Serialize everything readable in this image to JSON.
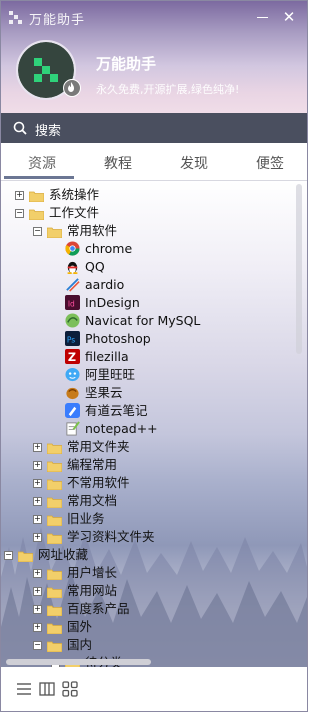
{
  "app": {
    "title": "万能助手"
  },
  "profile": {
    "name": "万能助手",
    "signature": "永久免费,开源扩展,绿色纯净!"
  },
  "search": {
    "label": "搜索"
  },
  "tabs": [
    {
      "label": "资源",
      "active": true
    },
    {
      "label": "教程",
      "active": false
    },
    {
      "label": "发现",
      "active": false
    },
    {
      "label": "便签",
      "active": false
    }
  ],
  "tree": {
    "items": [
      {
        "label": "系统操作",
        "expander": "+"
      },
      {
        "label": "工作文件",
        "expander": "−"
      },
      {
        "label": "常用软件",
        "expander": "−"
      },
      {
        "label": "chrome",
        "icon": "chrome-icon"
      },
      {
        "label": "QQ",
        "icon": "qq-penguin-icon"
      },
      {
        "label": "aardio",
        "icon": "aardio-icon"
      },
      {
        "label": "InDesign",
        "icon": "indesign-icon"
      },
      {
        "label": "Navicat for MySQL",
        "icon": "navicat-icon"
      },
      {
        "label": "Photoshop",
        "icon": "photoshop-icon"
      },
      {
        "label": "filezilla",
        "icon": "filezilla-icon"
      },
      {
        "label": "阿里旺旺",
        "icon": "aliwangwang-icon"
      },
      {
        "label": "坚果云",
        "icon": "nutstore-icon"
      },
      {
        "label": "有道云笔记",
        "icon": "youdao-note-icon"
      },
      {
        "label": "notepad++",
        "icon": "notepadpp-icon"
      },
      {
        "label": "常用文件夹",
        "expander": "+"
      },
      {
        "label": "编程常用",
        "expander": "+"
      },
      {
        "label": "不常用软件",
        "expander": "+"
      },
      {
        "label": "常用文档",
        "expander": "+"
      },
      {
        "label": "旧业务",
        "expander": "+"
      },
      {
        "label": "学习资料文件夹",
        "expander": "+"
      },
      {
        "label": "网址收藏",
        "expander": "−"
      },
      {
        "label": "用户增长",
        "expander": "+"
      },
      {
        "label": "常用网站",
        "expander": "+"
      },
      {
        "label": "百度系产品",
        "expander": "+"
      },
      {
        "label": "国外",
        "expander": "+"
      },
      {
        "label": "国内",
        "expander": "−"
      },
      {
        "label": "待分类",
        "expander": "+"
      }
    ]
  },
  "colors": {
    "header_top": "#7c6aa0",
    "search_bg": "#4a4f5f",
    "tab_indicator": "#6b7693",
    "folder": "#f2cf6a"
  }
}
